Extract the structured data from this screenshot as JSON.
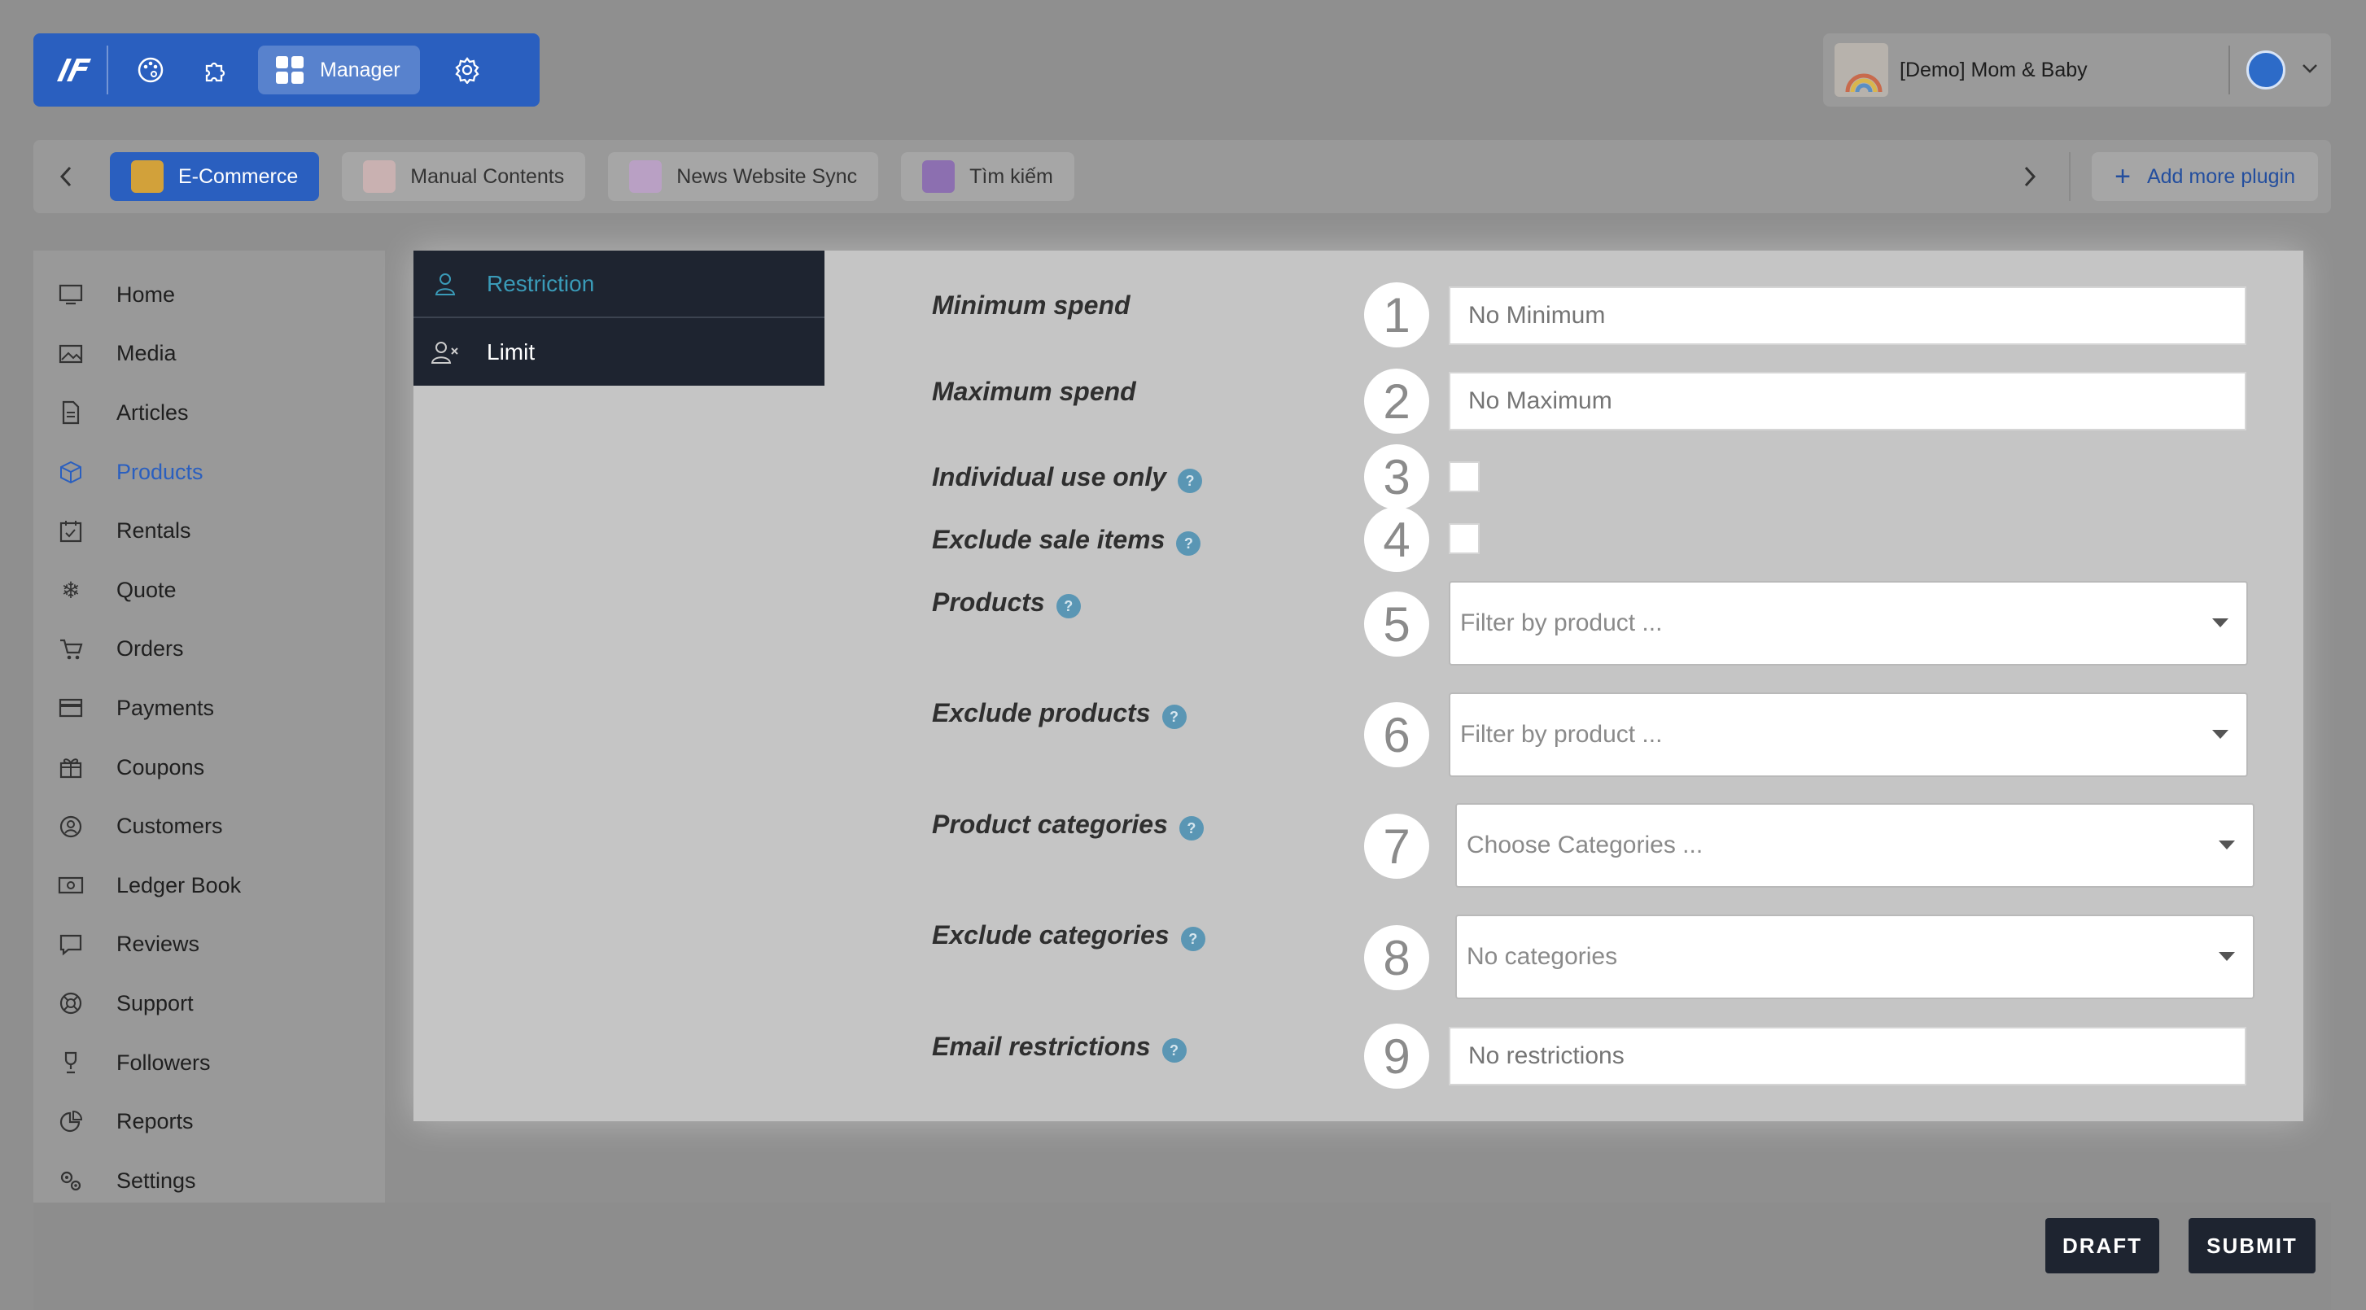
{
  "header": {
    "logo_icon": "studio-logo-icon",
    "tools": [
      "palette-icon",
      "puzzle-icon"
    ],
    "manager_label": "Manager",
    "settings_icon": "gear-icon",
    "shop_name": "[Demo] Mom & Baby"
  },
  "plugins": {
    "tabs": [
      {
        "label": "E-Commerce",
        "active": true
      },
      {
        "label": "Manual Contents",
        "active": false
      },
      {
        "label": "News Website Sync",
        "active": false
      },
      {
        "label": "Tìm kiếm",
        "active": false
      }
    ],
    "add_label": "Add more plugin"
  },
  "sidebar": {
    "items": [
      {
        "label": "Home",
        "icon": "monitor-icon"
      },
      {
        "label": "Media",
        "icon": "image-icon"
      },
      {
        "label": "Articles",
        "icon": "document-icon"
      },
      {
        "label": "Products",
        "icon": "box-icon",
        "active": true
      },
      {
        "label": "Rentals",
        "icon": "calendar-icon"
      },
      {
        "label": "Quote",
        "icon": "snowflake-icon"
      },
      {
        "label": "Orders",
        "icon": "cart-icon"
      },
      {
        "label": "Payments",
        "icon": "credit-card-icon"
      },
      {
        "label": "Coupons",
        "icon": "gift-icon"
      },
      {
        "label": "Customers",
        "icon": "user-circle-icon"
      },
      {
        "label": "Ledger Book",
        "icon": "cash-icon"
      },
      {
        "label": "Reviews",
        "icon": "chat-icon"
      },
      {
        "label": "Support",
        "icon": "lifebuoy-icon"
      },
      {
        "label": "Followers",
        "icon": "trophy-icon"
      },
      {
        "label": "Reports",
        "icon": "pie-chart-icon"
      },
      {
        "label": "Settings",
        "icon": "gears-icon"
      }
    ]
  },
  "tabs": [
    {
      "label": "Restriction",
      "active": true,
      "icon": "user-icon"
    },
    {
      "label": "Limit",
      "active": false,
      "icon": "user-x-icon"
    }
  ],
  "form": {
    "min_spend": {
      "label": "Minimum spend",
      "num": "1",
      "placeholder": "No Minimum"
    },
    "max_spend": {
      "label": "Maximum spend",
      "num": "2",
      "placeholder": "No Maximum"
    },
    "individual": {
      "label": "Individual use only",
      "num": "3",
      "checked": false
    },
    "exclude_sale": {
      "label": "Exclude sale items",
      "num": "4",
      "checked": false
    },
    "products": {
      "label": "Products",
      "num": "5",
      "placeholder": "Filter by product ..."
    },
    "exclude_products": {
      "label": "Exclude products",
      "num": "6",
      "placeholder": "Filter by product ..."
    },
    "categories": {
      "label": "Product categories",
      "num": "7",
      "placeholder": "Choose Categories ..."
    },
    "exclude_categories": {
      "label": "Exclude categories",
      "num": "8",
      "placeholder": "No categories"
    },
    "email": {
      "label": "Email restrictions",
      "num": "9",
      "placeholder": "No restrictions"
    }
  },
  "footer": {
    "draft_label": "DRAFT",
    "submit_label": "SUBMIT"
  },
  "colors": {
    "accent": "#2a5fbf",
    "dark": "#1e2430",
    "tab_active": "#3a9bb8"
  }
}
